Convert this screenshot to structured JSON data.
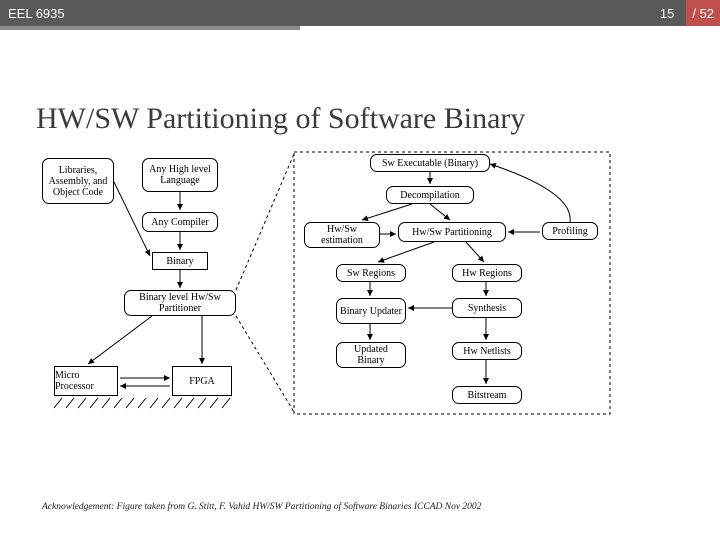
{
  "header": {
    "course": "EEL 6935",
    "page_current": "15",
    "page_total": "/ 52"
  },
  "title": "HW/SW Partitioning of Software Binary",
  "ack": "Acknowledgement: Figure taken from G. Stitt, F. Vahid HW/SW Partitioning of Software Binaries ICCAD Nov 2002",
  "diagram": {
    "left_col": {
      "libs": "Libraries, Assembly, and Object Code",
      "hll": "Any High level Language",
      "compiler": "Any Compiler",
      "binary": "Binary",
      "partitioner": "Binary level Hw/Sw Partitioner",
      "micro": "Micro Processor",
      "fpga": "FPGA"
    },
    "right_col": {
      "exe": "Sw Executable (Binary)",
      "decomp": "Decompilation",
      "est": "Hw/Sw estimation",
      "part": "Hw/Sw Partitioning",
      "profiling": "Profiling",
      "swreg": "Sw Regions",
      "hwreg": "Hw Regions",
      "updater": "Binary Updater",
      "synth": "Synthesis",
      "updbin": "Updated Binary",
      "netlists": "Hw Netlists",
      "bitstream": "Bitstream"
    }
  }
}
